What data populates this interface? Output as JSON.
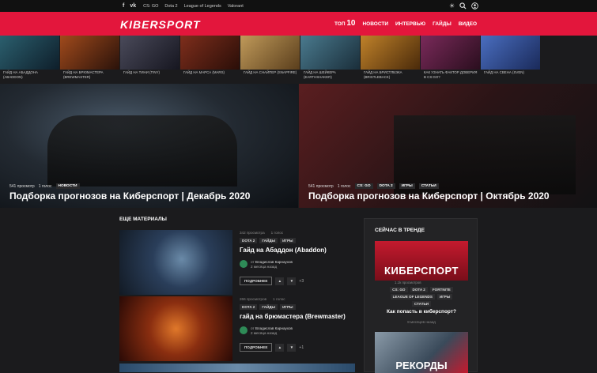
{
  "topbar": {
    "social": [
      "f",
      "vk"
    ],
    "links": [
      "CS: GO",
      "Dota 2",
      "League of Legends",
      "Valorant"
    ],
    "tools": [
      "theme-icon",
      "search-icon",
      "user-icon"
    ]
  },
  "header": {
    "logo": "KIBERSPORT",
    "nav": {
      "top_label": "ТОП",
      "top_num": "10",
      "items": [
        "НОВОСТИ",
        "ИНТЕРВЬЮ",
        "ГАЙДЫ",
        "ВИДЕО"
      ]
    }
  },
  "strip": [
    {
      "caption": "ГАЙД НА АБАДДОНА (ABADDON)",
      "color": "#2b5f6e"
    },
    {
      "caption": "ГАЙД НА БРЮМАСТЕРА (BREWMASTER)",
      "color": "#7a3a1c"
    },
    {
      "caption": "ГАЙД НА ТИНИ (TINY)",
      "color": "#4a4a5a"
    },
    {
      "caption": "ГАЙД НА МАРСА (MARS)",
      "color": "#5e2a1c"
    },
    {
      "caption": "ГАЙД НА СНАЙПЕР (SNAPFIRE)",
      "color": "#8a6e3a"
    },
    {
      "caption": "ГАЙД НА ШЕЙКЕРА (EARTHSHAKER)",
      "color": "#3a5a6e"
    },
    {
      "caption": "ГАЙД НА БРИСТЛБЭКА (BRISTLEBACK)",
      "color": "#8a5a1c"
    },
    {
      "caption": "КАК УЗНАТЬ ФАКТОР ДОВЕРИЯ В CS:GO?",
      "color": "#5a2a4a"
    },
    {
      "caption": "ГАЙД НА СВЕНА (SVEN)",
      "color": "#3a4e7a"
    }
  ],
  "heroes": [
    {
      "views": "541 просмотр",
      "comments": "1 голос",
      "tags": [
        "НОВОСТИ"
      ],
      "title": "Подборка прогнозов на Киберспорт | Декабрь 2020"
    },
    {
      "views": "541 просмотр",
      "comments": "1 голос",
      "tags": [
        "CS: GO",
        "DOTA 2",
        "ИГРЫ",
        "СТАТЬИ"
      ],
      "title": "Подборка прогнозов на Киберспорт | Октябрь 2020"
    }
  ],
  "section_title": "ЕЩЕ МАТЕРИАЛЫ",
  "articles": [
    {
      "views": "342 просмотра",
      "comments": "1 голос",
      "tags": [
        "DOTA 2",
        "ГАЙДЫ",
        "ИГРЫ"
      ],
      "title": "Гайд на Абаддон (Abaddon)",
      "by": "от",
      "author": "Владислав Карнаухов",
      "ago": "2 месяца назад",
      "button": "ПОДРОБНЕЕ",
      "count": "+3"
    },
    {
      "views": "266 просмотров",
      "comments": "1 голос",
      "tags": [
        "DOTA 2",
        "ГАЙДЫ",
        "ИГРЫ"
      ],
      "title": "гайд на брюмастера (Brewmaster)",
      "by": "от",
      "author": "Владислав Карнаухов",
      "ago": "2 месяца назад",
      "button": "ПОДРОБНЕЕ",
      "count": "+1"
    }
  ],
  "trend": {
    "title": "СЕЙЧАС В ТРЕНДЕ",
    "banner1": "КИБЕРСПОРТ",
    "views": "1.1k просмотров",
    "tags": [
      "CS: GO",
      "DOTA 2",
      "FORTNITE",
      "LEAGUE OF LEGENDS",
      "ИГРЫ",
      "СТАТЬИ"
    ],
    "question": "Как попасть в киберспорт?",
    "ago": "8 месяцев назад",
    "banner2": "РЕКОРДЫ"
  },
  "colors": {
    "accent": "#e3163c",
    "bg": "#1b1b1d"
  }
}
